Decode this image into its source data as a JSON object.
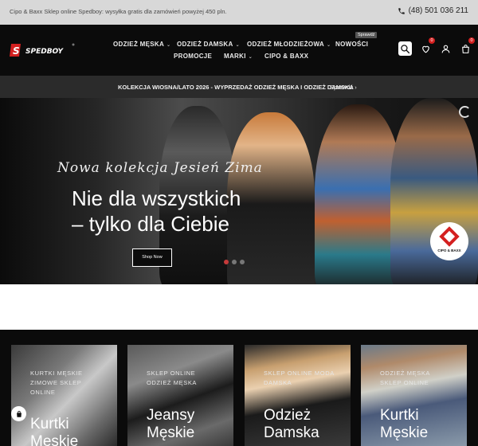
{
  "topbar": {
    "promo": "Cipo & Baxx Sklep online Spedboy: wysyłka gratis dla zamówień powyżej 450 pln.",
    "phone": "(48) 501 036 211",
    "phone_icon": "phone-icon"
  },
  "header": {
    "logo": "SPEDBOY",
    "nav": [
      {
        "label": "ODZIEŻ MĘSKA",
        "has_caret": true
      },
      {
        "label": "ODZIEŻ DAMSKA",
        "has_caret": true
      },
      {
        "label": "ODZIEŻ MŁODZIEŻOWA",
        "has_caret": true
      },
      {
        "label": "NOWOŚCI",
        "has_caret": false
      },
      {
        "label": "PROMOCJE",
        "has_caret": false
      },
      {
        "label": "MARKI",
        "has_caret": true
      },
      {
        "label": "CIPO & BAXX",
        "has_caret": false
      }
    ],
    "new_badge": "Sprawdź",
    "icons": [
      "search-icon",
      "heart-icon",
      "user-icon",
      "bag-icon"
    ],
    "wishlist_count": "0",
    "cart_count": "0"
  },
  "announcement": {
    "message": "KOLEKCJA WIOSNA/LATO 2026 - WYPRZEDAŻ ODZIEŻ MĘSKA I ODZIEŻ DAMSKA",
    "cta": "Sprawdź",
    "cta_icon": "chevron-right-icon"
  },
  "hero": {
    "script_title": "Nowa kolekcja Jesień Zima",
    "headline_line1": "Nie dla wszystkich",
    "headline_line2": "– tylko dla Ciebie",
    "button": "Shop Now",
    "slides": 3,
    "active_slide": 1,
    "brand_badge": "CIPO & BAXX"
  },
  "categories": [
    {
      "kicker_lines": [
        "KURTKI MĘSKIE",
        "ZIMOWE SKLEP",
        "ONLINE"
      ],
      "title_lines": [
        "Kurtki",
        "Męskie"
      ]
    },
    {
      "kicker_lines": [
        "SKLEP ONLINE",
        "ODZIEŻ MĘSKA"
      ],
      "title_lines": [
        "Jeansy",
        "Męskie"
      ]
    },
    {
      "kicker_lines": [
        "SKLEP ONLINE MODA",
        "DAMSKA"
      ],
      "title_lines": [
        "Odzież",
        "Damska"
      ]
    },
    {
      "kicker_lines": [
        "ODZIEŻ MĘSKA",
        "SKLEP ONLINE"
      ],
      "title_lines": [
        "Kurtki",
        "Męskie"
      ]
    }
  ],
  "colors": {
    "topbar_bg": "#d8d8d8",
    "header_bg": "#0b0b0b",
    "strip_bg": "#2b2b2b",
    "accent": "#d42020"
  }
}
